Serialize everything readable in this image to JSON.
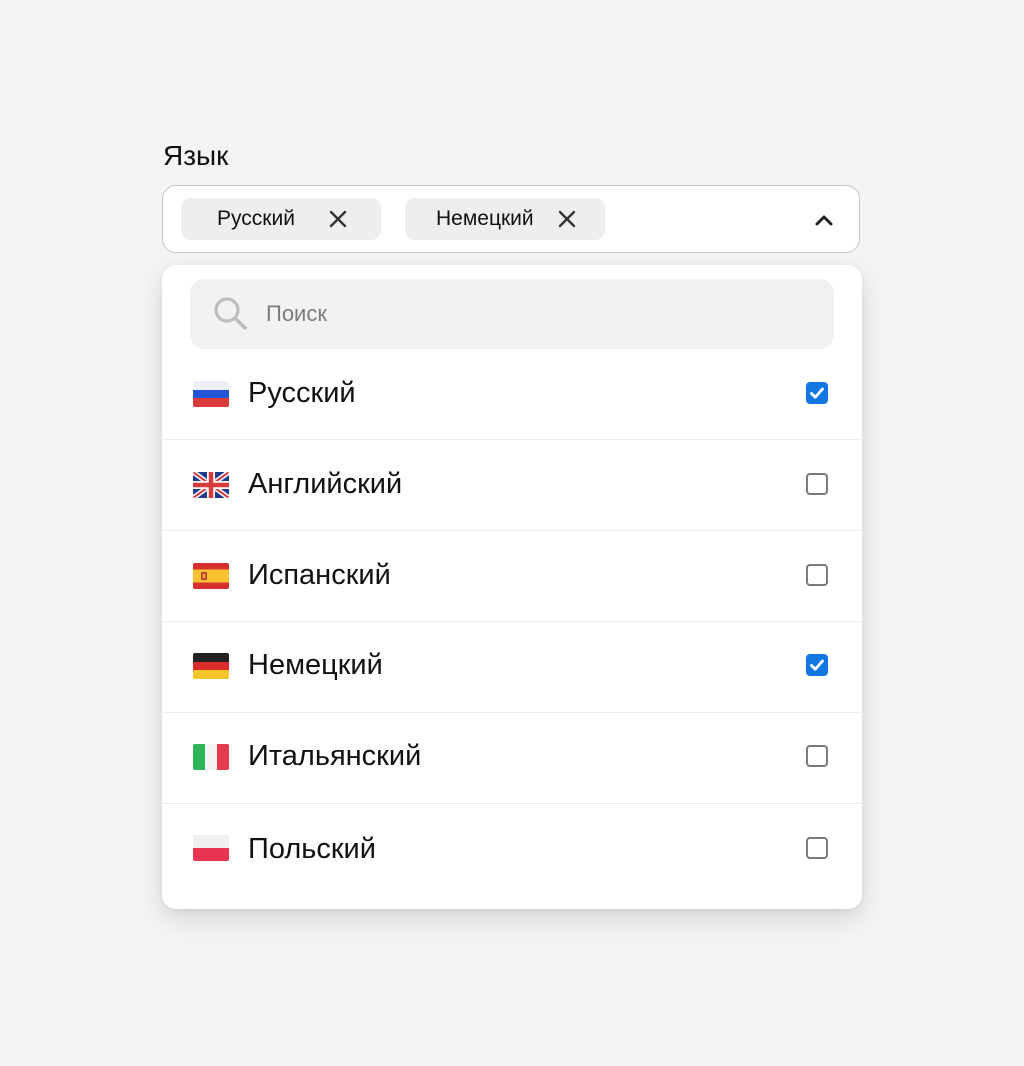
{
  "field": {
    "label": "Язык"
  },
  "selected_chips": [
    {
      "label": "Русский"
    },
    {
      "label": "Немецкий"
    }
  ],
  "search": {
    "placeholder": "Поиск",
    "value": ""
  },
  "options": [
    {
      "label": "Русский",
      "flag": "russia-flag-icon",
      "checked": true
    },
    {
      "label": "Английский",
      "flag": "uk-flag-icon",
      "checked": false
    },
    {
      "label": "Испанский",
      "flag": "spain-flag-icon",
      "checked": false
    },
    {
      "label": "Немецкий",
      "flag": "germany-flag-icon",
      "checked": true
    },
    {
      "label": "Итальянский",
      "flag": "italy-flag-icon",
      "checked": false
    },
    {
      "label": "Польский",
      "flag": "poland-flag-icon",
      "checked": false
    }
  ],
  "colors": {
    "accent": "#1276e3",
    "background": "#f4f4f4"
  }
}
